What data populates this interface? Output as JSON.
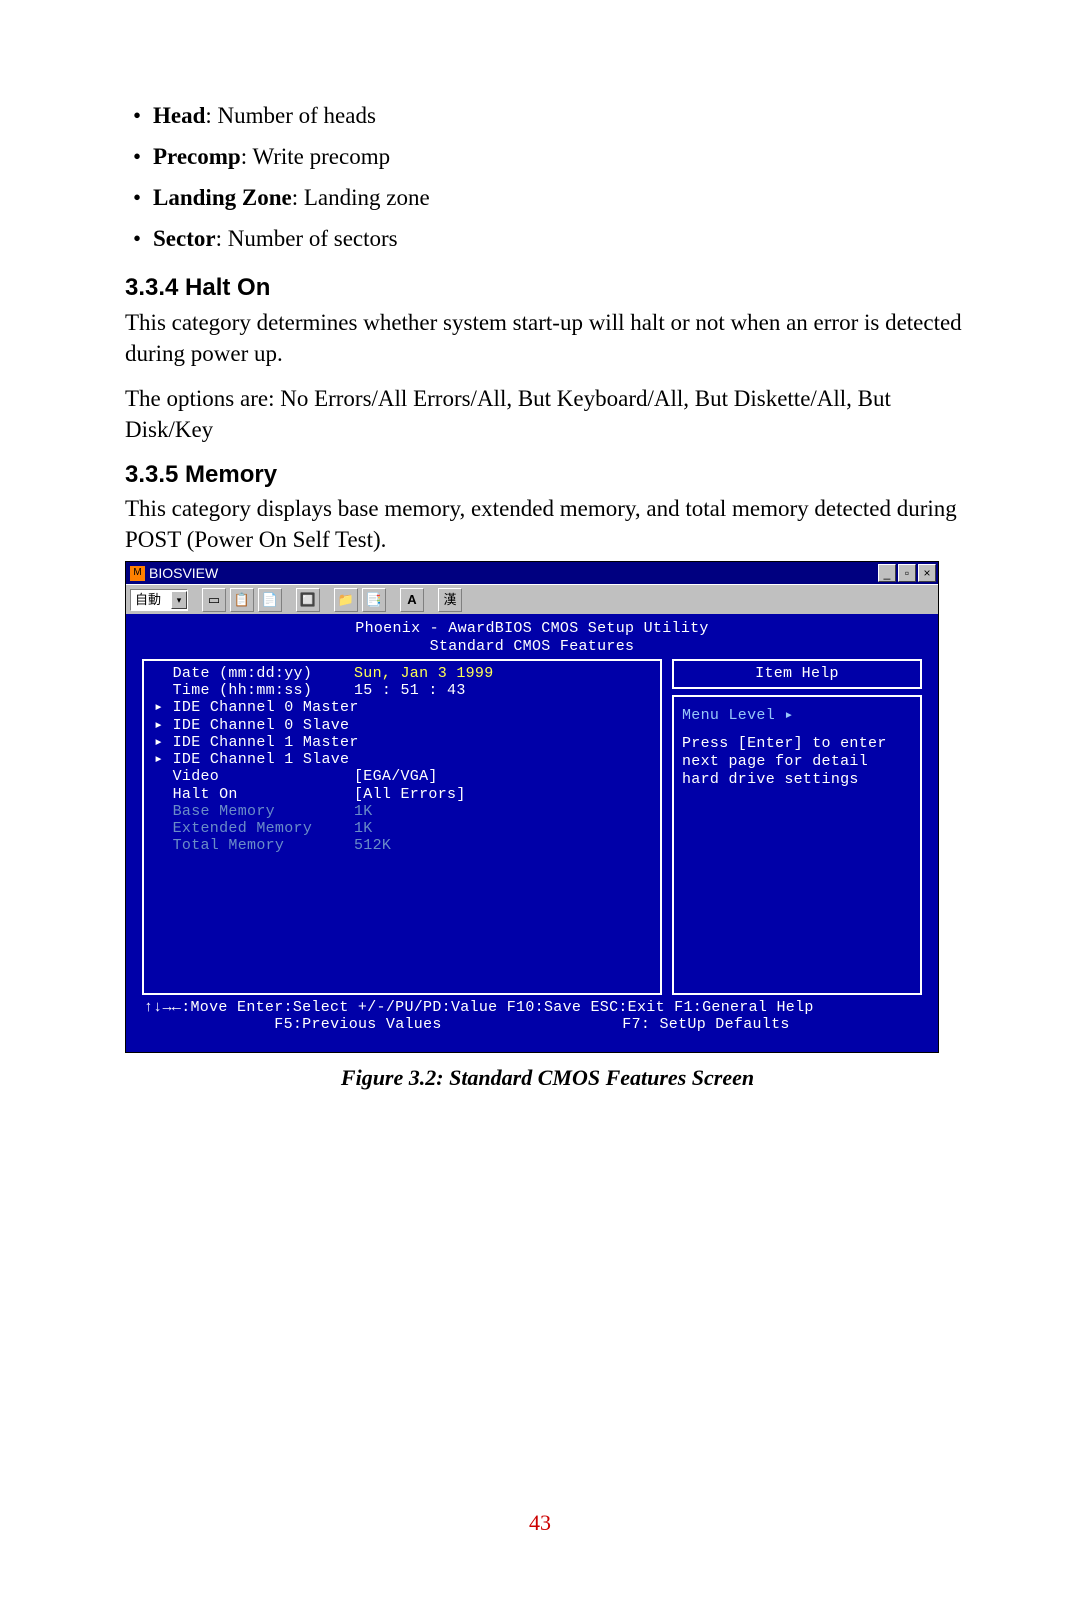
{
  "definitions": [
    {
      "term": "Head",
      "desc": "Number of heads"
    },
    {
      "term": "Precomp",
      "desc": "Write precomp"
    },
    {
      "term": "Landing Zone",
      "desc": "Landing zone"
    },
    {
      "term": "Sector",
      "desc": "Number of sectors"
    }
  ],
  "section_halt": {
    "heading": "3.3.4 Halt On",
    "p1": "This category determines whether system start-up will halt or not when an error is detected during power up.",
    "p2": "The options are: No Errors/All Errors/All, But Keyboard/All, But Diskette/All, But Disk/Key"
  },
  "section_memory": {
    "heading": "3.3.5 Memory",
    "p1": "This category displays base memory, extended memory, and total memory detected during POST (Power On Self Test)."
  },
  "bios": {
    "window_title": "BIOSVIEW",
    "toolbar_dropdown": "自動",
    "toolbar_icons": [
      "▭",
      "📋",
      "📄",
      "🔲",
      "📁",
      "📑",
      "A",
      "漢"
    ],
    "title_line1": "Phoenix - AwardBIOS CMOS Setup Utility",
    "title_line2": "Standard CMOS Features",
    "left_rows": [
      {
        "lbl": "  Date (mm:dd:yy)",
        "val": "Sun, Jan  3 1999",
        "yellow": true
      },
      {
        "lbl": "  Time (hh:mm:ss)",
        "val": "15 : 51 : 43"
      },
      {
        "lbl": "",
        "val": ""
      },
      {
        "lbl": "▸ IDE Channel 0 Master",
        "val": ""
      },
      {
        "lbl": "▸ IDE Channel 0 Slave",
        "val": ""
      },
      {
        "lbl": "▸ IDE Channel 1 Master",
        "val": ""
      },
      {
        "lbl": "▸ IDE Channel 1 Slave",
        "val": ""
      },
      {
        "lbl": "",
        "val": ""
      },
      {
        "lbl": "  Video",
        "val": "[EGA/VGA]"
      },
      {
        "lbl": "  Halt On",
        "val": "[All Errors]"
      },
      {
        "lbl": "",
        "val": ""
      },
      {
        "lbl": "  Base Memory",
        "val": "   1K",
        "dim": true
      },
      {
        "lbl": "  Extended Memory",
        "val": "   1K",
        "dim": true
      },
      {
        "lbl": "  Total Memory",
        "val": " 512K",
        "dim": true
      }
    ],
    "help": {
      "title": "Item Help",
      "level": "Menu Level    ▸",
      "text": "Press [Enter] to enter next page for detail hard drive settings"
    },
    "footer": {
      "r1": "↑↓→←:Move  Enter:Select  +/-/PU/PD:Value  F10:Save  ESC:Exit  F1:General Help",
      "r2a": "F5:Previous Values",
      "r2b": "F7: SetUp Defaults"
    }
  },
  "figure_caption": "Figure 3.2: Standard CMOS Features Screen",
  "page_number": "43"
}
